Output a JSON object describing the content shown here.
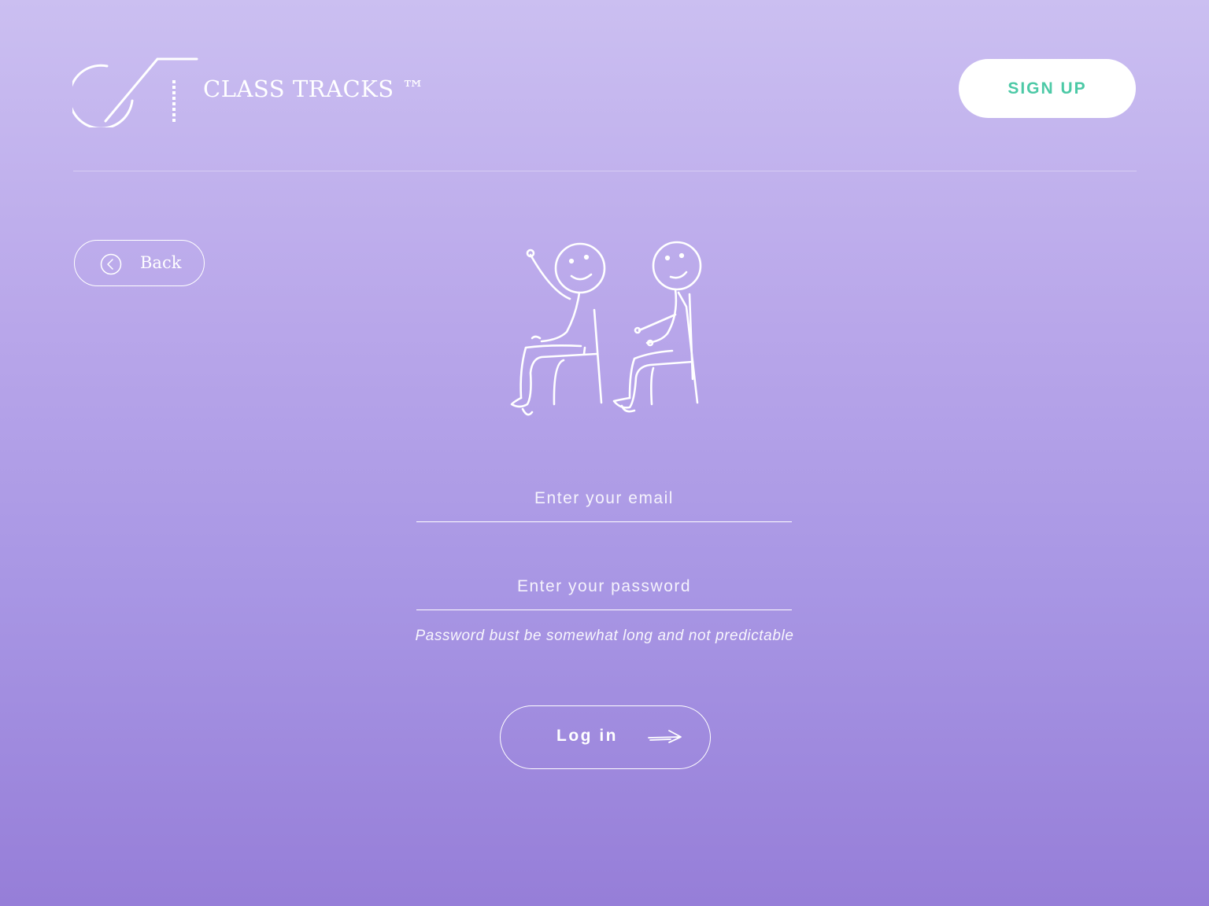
{
  "header": {
    "brand_name": "CLASS TRACKS ™",
    "signup_label": "SIGN UP"
  },
  "navigation": {
    "back_label": "Back"
  },
  "illustration": {
    "icon": "students-sitting-illustration"
  },
  "form": {
    "email_placeholder": "Enter your email",
    "password_placeholder": "Enter your password",
    "password_hint": "Password bust be somewhat long and not predictable",
    "login_label": "Log in"
  },
  "colors": {
    "accent": "#4cc9a6",
    "background_top": "#cbbff1",
    "background_bottom": "#967ed8",
    "foreground": "#ffffff"
  }
}
